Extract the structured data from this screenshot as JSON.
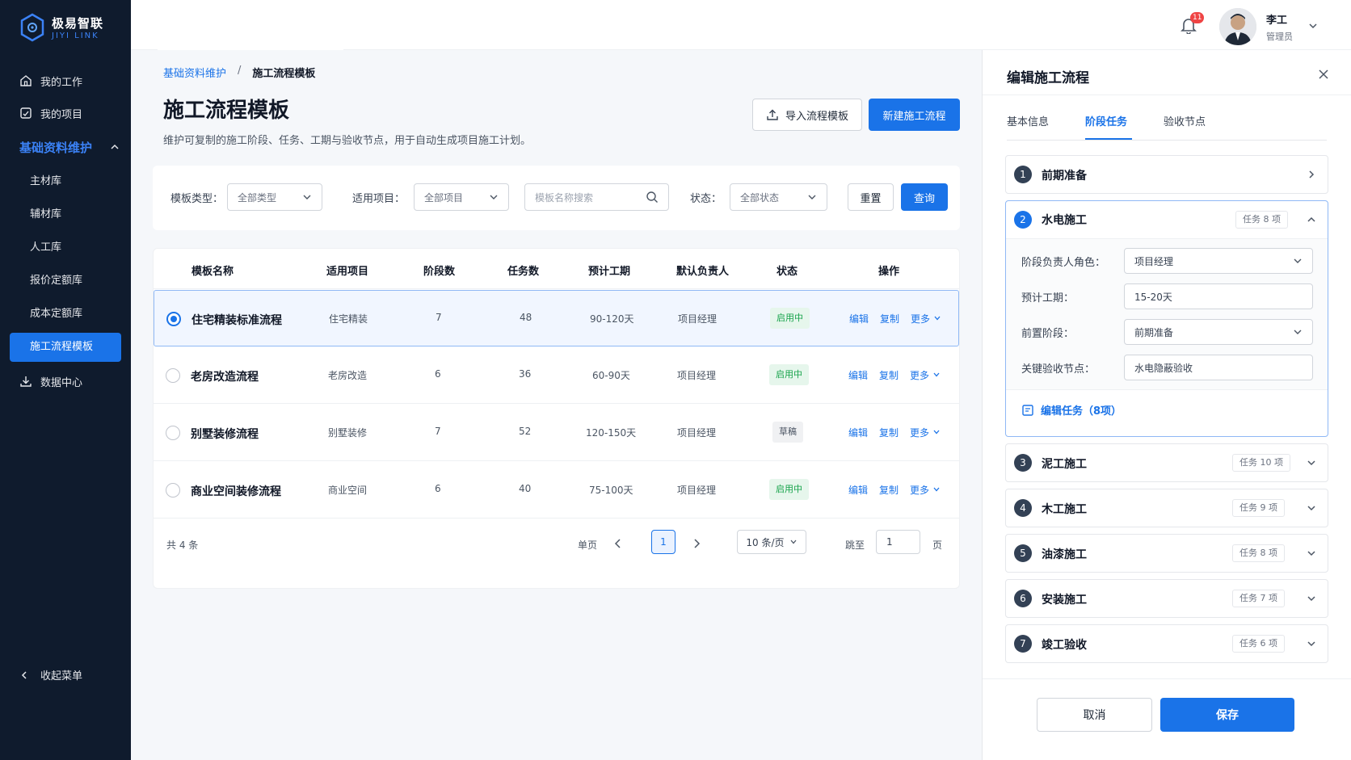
{
  "app": {
    "logo_cn": "极易智联",
    "logo_en": "JIYI LINK"
  },
  "sidebar": {
    "items": [
      {
        "label": "我的工作",
        "icon": "home-icon"
      },
      {
        "label": "我的项目",
        "icon": "project-icon"
      }
    ],
    "group": {
      "label": "基础资料维护",
      "expanded": true
    },
    "sub_items": [
      {
        "label": "主材库"
      },
      {
        "label": "辅材库"
      },
      {
        "label": "人工库"
      },
      {
        "label": "报价定额库"
      },
      {
        "label": "成本定额库"
      },
      {
        "label": "施工流程模板",
        "active": true
      }
    ],
    "data_center": "数据中心",
    "collapse_label": "收起菜单"
  },
  "topbar": {
    "notification_count": "11",
    "user_name": "李工",
    "user_role": "管理员"
  },
  "breadcrumb": {
    "parent": "基础资料维护",
    "separator": "/",
    "current": "施工流程模板"
  },
  "page": {
    "title": "施工流程模板",
    "description": "维护可复制的施工阶段、任务、工期与验收节点，用于自动生成项目施工计划。",
    "import_label": "导入流程模板",
    "new_label": "新建施工流程"
  },
  "filters": {
    "type_label": "模板类型：",
    "type_value": "全部类型",
    "project_label": "适用项目：",
    "project_value": "全部项目",
    "search_placeholder": "模板名称搜索",
    "status_label": "状态：",
    "status_value": "全部状态",
    "reset_label": "重置",
    "query_label": "查询"
  },
  "table": {
    "headers": [
      "模板名称",
      "适用项目",
      "阶段数",
      "任务数",
      "预计工期",
      "默认负责人",
      "状态",
      "操作"
    ],
    "rows": [
      {
        "name": "住宅精装标准流程",
        "project": "住宅精装",
        "stages": "7",
        "tasks": "48",
        "duration": "90-120天",
        "owner": "项目经理",
        "status": "启用中",
        "selected": true
      },
      {
        "name": "老房改造流程",
        "project": "老房改造",
        "stages": "6",
        "tasks": "36",
        "duration": "60-90天",
        "owner": "项目经理",
        "status": "启用中",
        "selected": false
      },
      {
        "name": "别墅装修流程",
        "project": "别墅装修",
        "stages": "7",
        "tasks": "52",
        "duration": "120-150天",
        "owner": "项目经理",
        "status": "草稿",
        "selected": false
      },
      {
        "name": "商业空间装修流程",
        "project": "商业空间",
        "stages": "6",
        "tasks": "40",
        "duration": "75-100天",
        "owner": "项目经理",
        "status": "启用中",
        "selected": false
      }
    ],
    "ops": {
      "edit": "编辑",
      "copy": "复制",
      "more": "更多"
    }
  },
  "pager": {
    "total": "共 4 条",
    "single": "单页",
    "current": "1",
    "size": "10 条/页",
    "jump": "跳至",
    "jump_value": "1",
    "page": "页"
  },
  "drawer": {
    "title": "编辑施工流程",
    "tabs": [
      "基本信息",
      "阶段任务",
      "验收节点"
    ],
    "active_tab": 1,
    "stages": [
      {
        "num": "1",
        "name": "前期准备",
        "count": ""
      },
      {
        "num": "2",
        "name": "水电施工",
        "count": "任务 8 项"
      },
      {
        "num": "3",
        "name": "泥工施工",
        "count": "任务 10 项"
      },
      {
        "num": "4",
        "name": "木工施工",
        "count": "任务 9 项"
      },
      {
        "num": "5",
        "name": "油漆施工",
        "count": "任务 8 项"
      },
      {
        "num": "6",
        "name": "安装施工",
        "count": "任务 7 项"
      },
      {
        "num": "7",
        "name": "竣工验收",
        "count": "任务 6 项"
      }
    ],
    "expanded": {
      "role_label": "阶段负责人角色：",
      "role_value": "项目经理",
      "duration_label": "预计工期：",
      "duration_value": "15-20天",
      "prev_label": "前置阶段：",
      "prev_value": "前期准备",
      "check_label": "关键验收节点：",
      "check_value": "水电隐蔽验收",
      "edit_tasks": "编辑任务（8项）"
    },
    "cancel_label": "取消",
    "save_label": "保存"
  },
  "colors": {
    "primary": "#1a73e8",
    "sidebar_bg": "#0f1b2d",
    "status_active": "#16a34a"
  }
}
